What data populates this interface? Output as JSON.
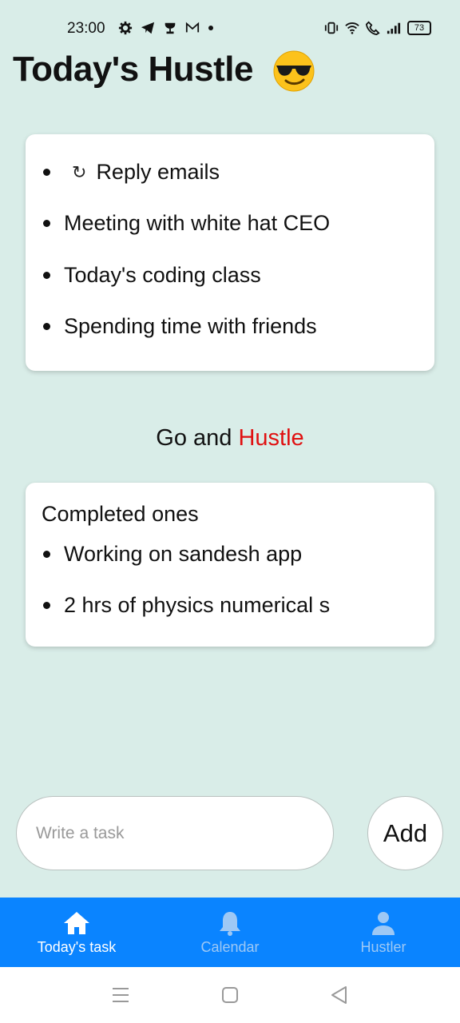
{
  "status_bar": {
    "time": "23:00",
    "left_icons": [
      "settings-icon",
      "telegram-icon",
      "trophy-icon",
      "gmail-icon",
      "dot-icon"
    ],
    "right_icons": [
      "vibrate-icon",
      "wifi-icon",
      "call-icon",
      "signal-icon"
    ],
    "battery": "73"
  },
  "header": {
    "title": "Today's Hustle",
    "emoji": "sunglasses-face-emoji"
  },
  "pending": {
    "tasks": [
      {
        "label": "Reply emails",
        "icon": "refresh-icon"
      },
      {
        "label": "Meeting with white hat CEO"
      },
      {
        "label": "Today's coding class"
      },
      {
        "label": "Spending time with friends"
      }
    ]
  },
  "motto": {
    "prefix": "Go and ",
    "highlight": "Hustle",
    "highlight_color": "#e01010"
  },
  "completed": {
    "heading": "Completed ones",
    "tasks": [
      {
        "label": "Working on sandesh app"
      },
      {
        "label": "2 hrs of physics numerical s"
      }
    ]
  },
  "composer": {
    "placeholder": "Write a task",
    "value": "",
    "add_label": "Add"
  },
  "bottom_nav": {
    "color": "#0a84ff",
    "items": [
      {
        "label": "Today's task",
        "icon": "home-icon",
        "active": true
      },
      {
        "label": "Calendar",
        "icon": "bell-icon",
        "active": false
      },
      {
        "label": "Hustler",
        "icon": "person-icon",
        "active": false
      }
    ]
  },
  "system_nav": {
    "icons": [
      "menu-icon",
      "home-square-icon",
      "back-icon"
    ]
  }
}
